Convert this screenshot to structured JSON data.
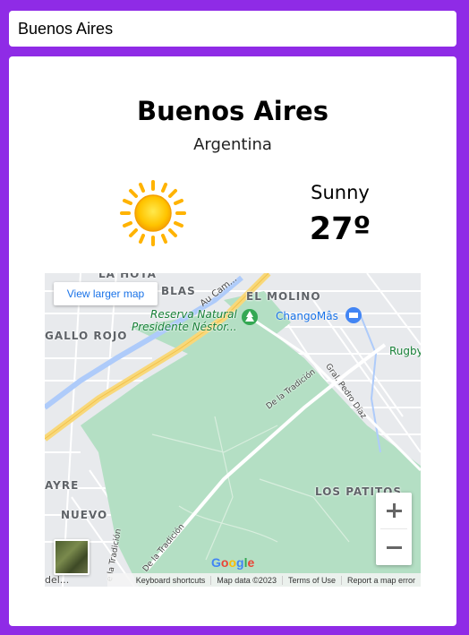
{
  "search": {
    "value": "Buenos Aires"
  },
  "weather": {
    "city": "Buenos Aires",
    "country": "Argentina",
    "condition": "Sunny",
    "temperature": "27º",
    "icon": "sun-icon"
  },
  "map": {
    "view_larger": "View larger map",
    "labels": {
      "la_horqueta": "LA HOTA",
      "blas": "BLAS",
      "au_cam": "Au Cam...",
      "el_molino": "EL MOLINO",
      "reserva": "Reserva Natural",
      "presidente": "Presidente Néstor...",
      "chango": "ChangoMâs",
      "gallo_rojo": "GALLO ROJO",
      "rugby": "Rugby",
      "de_la_tradicion_1": "De la Tradición",
      "gral_pedro_diaz": "Gral. Pedro Díaz",
      "los_patitos": "LOS PATITOS",
      "ayre": "AYRE",
      "nuevo": "NUEVO",
      "de_la_tradicion_2": "De la Tradición",
      "de_la_tradicion_3": "e la Tradición",
      "del": "del..."
    },
    "zoom_in": "+",
    "zoom_out": "−",
    "google_logo": "Google",
    "attribution": {
      "shortcuts": "Keyboard shortcuts",
      "data": "Map data ©2023",
      "terms": "Terms of Use",
      "report": "Report a map error"
    }
  },
  "colors": {
    "background": "#8f2be6",
    "park": "#b4dfc4",
    "road": "#ffffff",
    "highway": "#f8d87a",
    "water": "#aecbfa"
  }
}
